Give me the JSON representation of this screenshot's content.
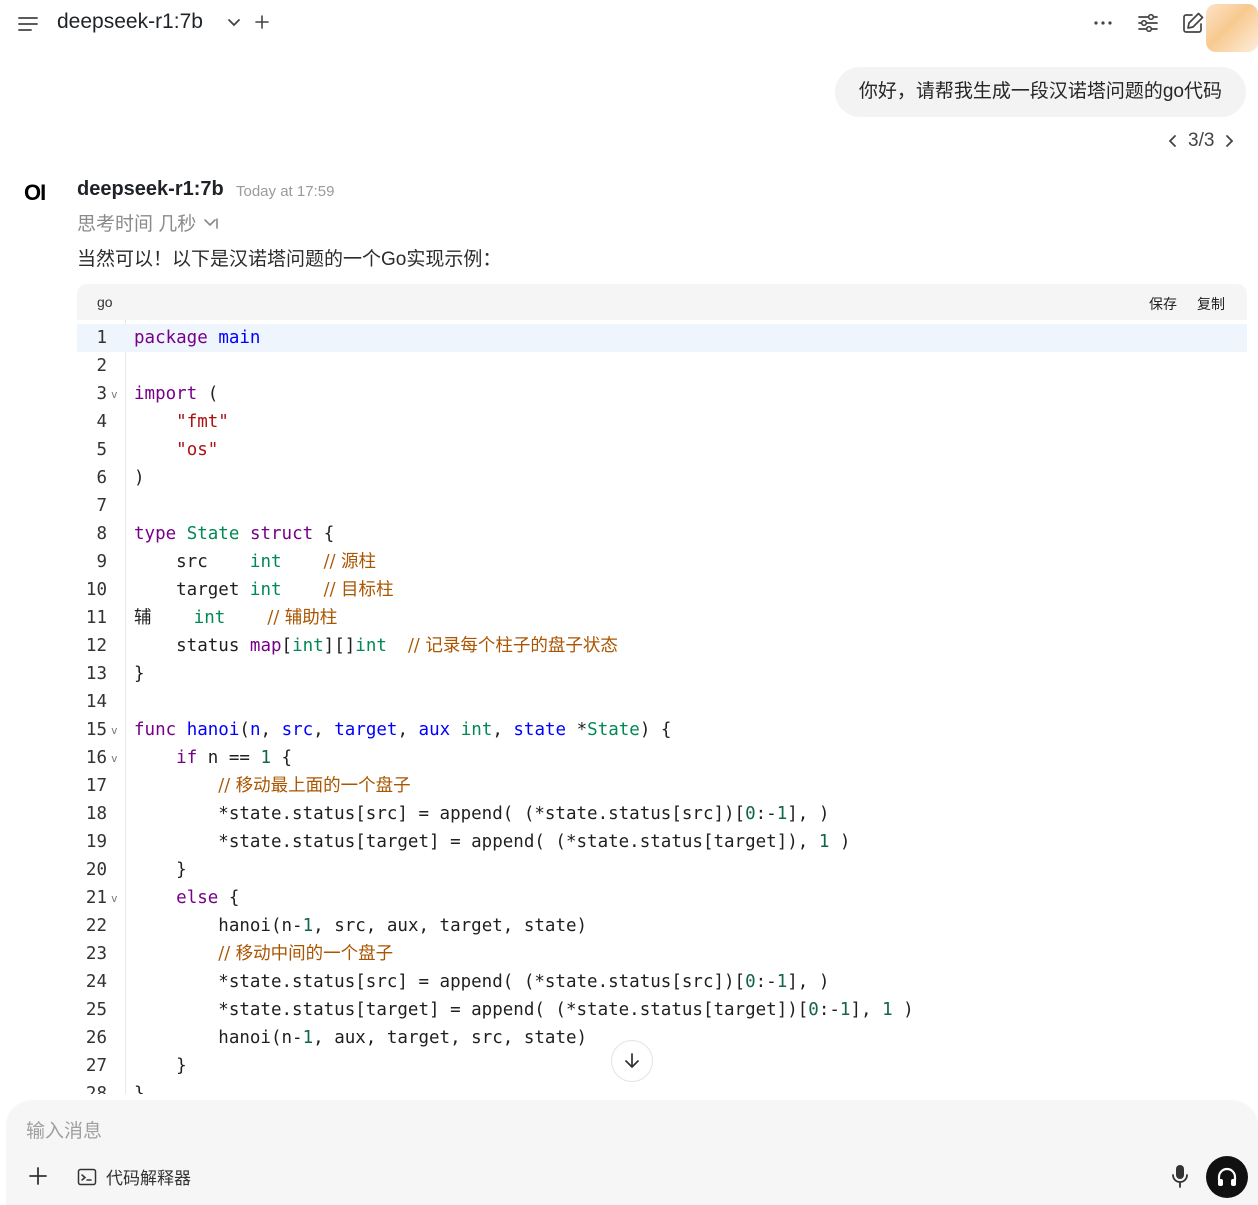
{
  "header": {
    "model_name": "deepseek-r1:7b",
    "icons": [
      "menu-icon",
      "chevron-down-icon",
      "plus-icon",
      "more-icon",
      "sliders-icon",
      "edit-icon"
    ]
  },
  "user_message": {
    "text": "你好，请帮我生成一段汉诺塔问题的go代码",
    "pager": "3/3"
  },
  "assistant": {
    "logo": "OI",
    "name": "deepseek-r1:7b",
    "timestamp": "Today at 17:59",
    "thinking": "思考时间 几秒",
    "intro": "当然可以！以下是汉诺塔问题的一个Go实现示例："
  },
  "code_block": {
    "language": "go",
    "save_label": "保存",
    "copy_label": "复制",
    "line_numbers": [
      "1",
      "2",
      "3",
      "4",
      "5",
      "6",
      "7",
      "8",
      "9",
      "10",
      "11",
      "12",
      "13",
      "14",
      "15",
      "16",
      "17",
      "18",
      "19",
      "20",
      "21",
      "22",
      "23",
      "24",
      "25",
      "26",
      "27",
      "28"
    ]
  },
  "input": {
    "placeholder": "输入消息",
    "tool_label": "代码解释器"
  },
  "colors": {
    "keyword": "#770088",
    "type": "#008855",
    "function": "#0000ff",
    "string": "#aa1111",
    "comment": "#aa5500",
    "active_line": "#eef5fd"
  }
}
